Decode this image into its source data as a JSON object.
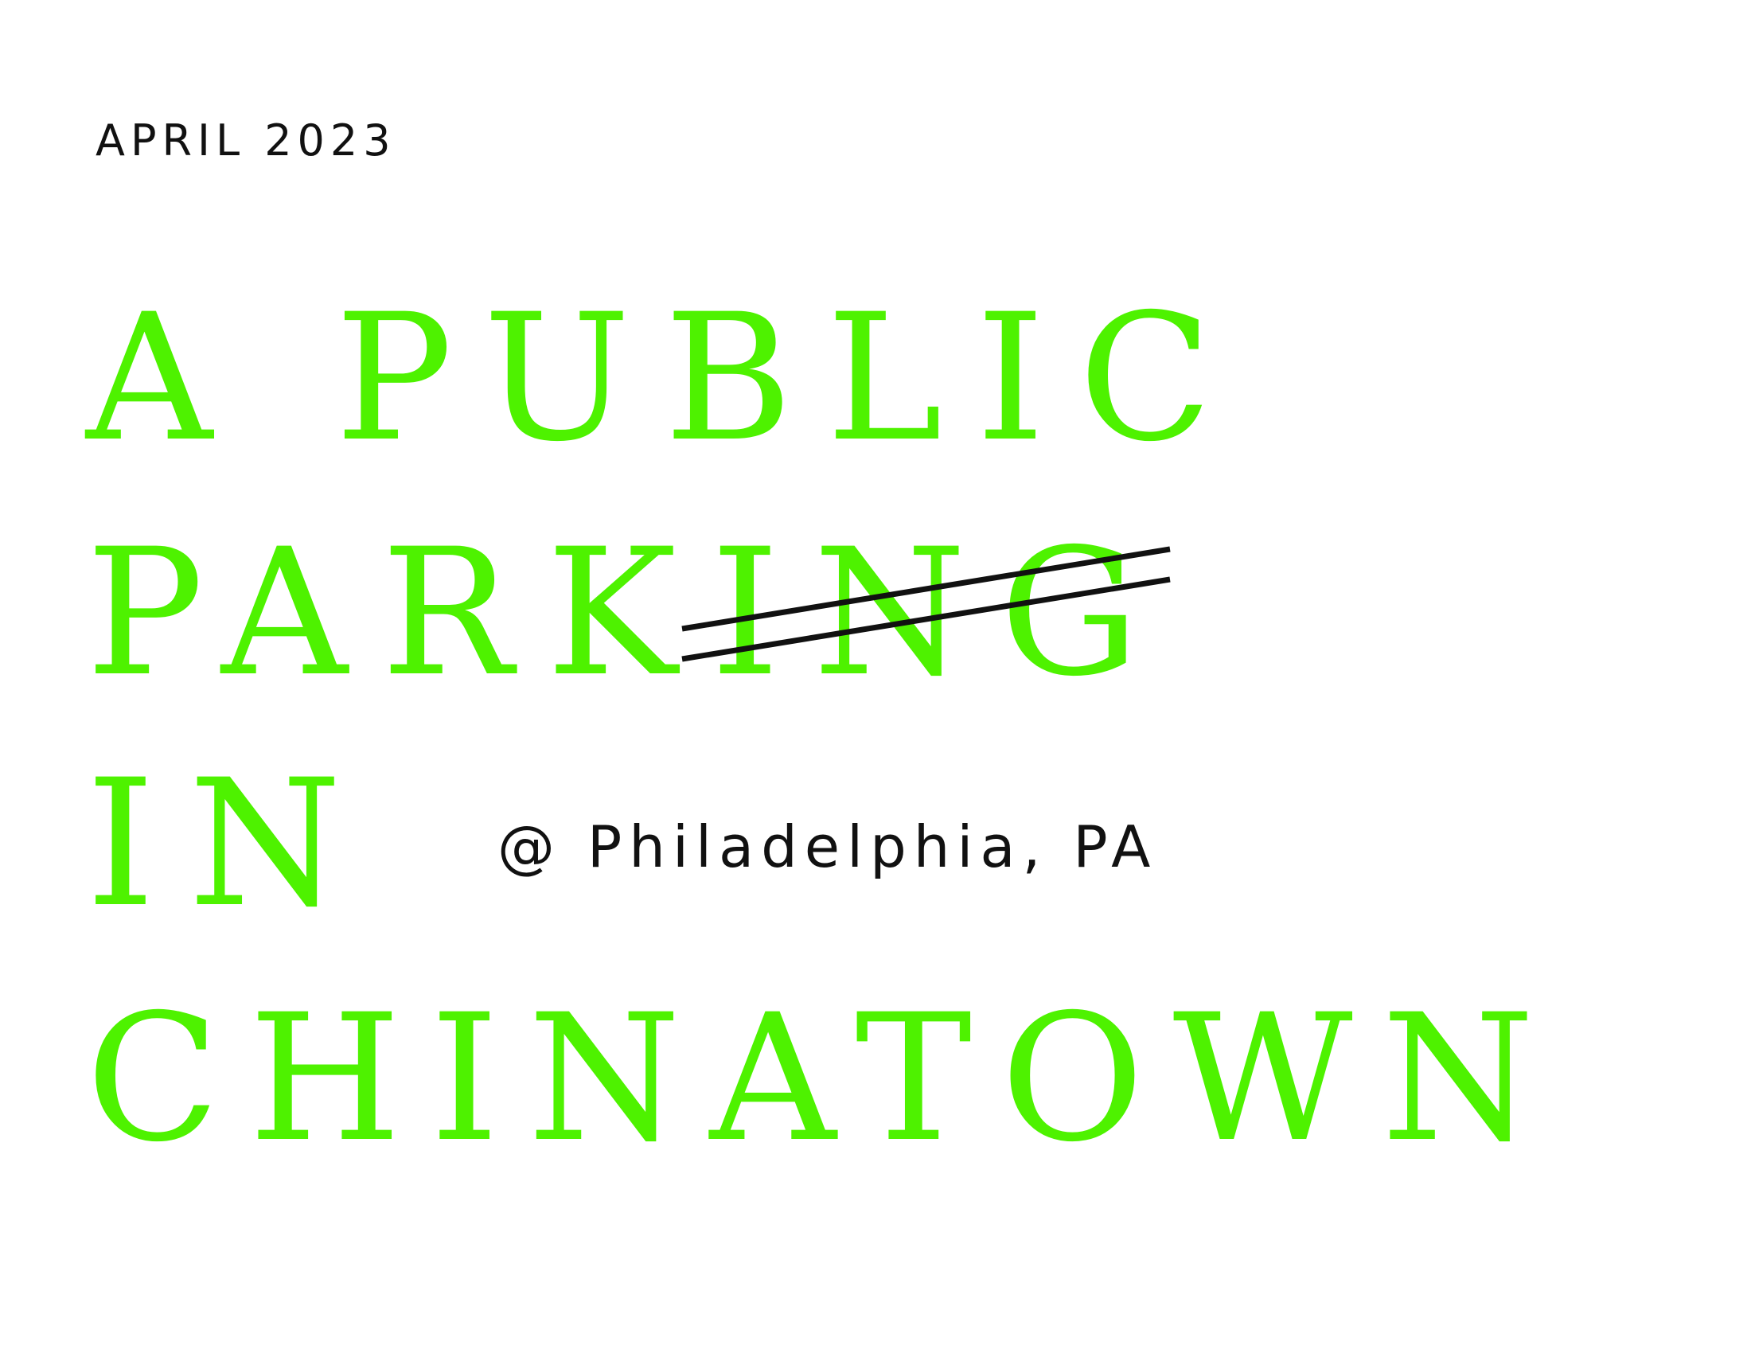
{
  "cover": {
    "date": "APRIL 2023",
    "title_line1": "A PUBLIC",
    "title_line2_kept": "PARK",
    "title_line2_struck": "ING",
    "title_line3": "IN",
    "title_line4": "CHINATOWN",
    "location": "@ Philadelphia, PA"
  },
  "colors": {
    "accent": "#4ef200",
    "text": "#111111",
    "background": "#ffffff"
  }
}
